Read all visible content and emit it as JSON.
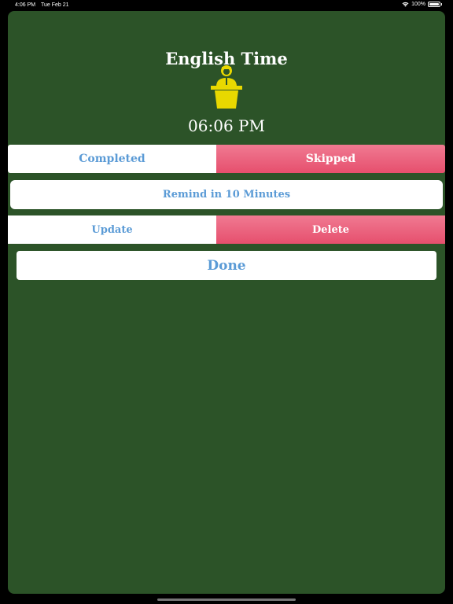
{
  "status_bar": {
    "time": "4:06 PM",
    "date": "Tue Feb 21",
    "battery": "100%"
  },
  "main": {
    "title": "English Time",
    "icon": "speaker-podium-icon",
    "time": "06:06 PM"
  },
  "buttons": {
    "completed": "Completed",
    "skipped": "Skipped",
    "remind": "Remind in 10 Minutes",
    "update": "Update",
    "delete": "Delete",
    "done": "Done"
  },
  "colors": {
    "background": "#2c5328",
    "accent_blue": "#5b9bd6",
    "danger_red": "#e64f6d",
    "icon_yellow": "#e8d800"
  }
}
